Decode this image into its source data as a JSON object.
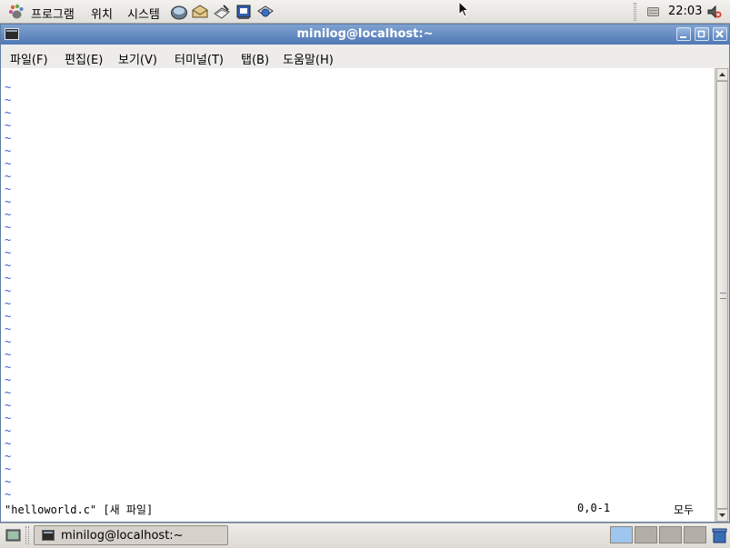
{
  "top_panel": {
    "menus": [
      "프로그램",
      "위치",
      "시스템"
    ],
    "launchers": [
      "web-browser-icon",
      "mail-icon",
      "writer-icon",
      "presentation-icon",
      "spreadsheet-icon"
    ],
    "clock": "22:03"
  },
  "window": {
    "title": "minilog@localhost:~",
    "menu": [
      {
        "label": "파일(F)"
      },
      {
        "label": "편집(E)"
      },
      {
        "label": "보기(V)"
      },
      {
        "label": "터미널(T)"
      },
      {
        "label": "탭(B)"
      },
      {
        "label": "도움말(H)"
      }
    ]
  },
  "terminal": {
    "tilde": "~",
    "tilde_count": 33,
    "status_file": "\"helloworld.c\" [새 파일]",
    "status_position": "0,0-1",
    "status_scroll": "모두"
  },
  "taskbar": {
    "task_label": "minilog@localhost:~"
  },
  "colors": {
    "titlebar": "#5a82bd",
    "tilde": "#3d58c7",
    "workspace_active": "#9fc6ee",
    "workspace_inactive": "#b4afa6"
  }
}
